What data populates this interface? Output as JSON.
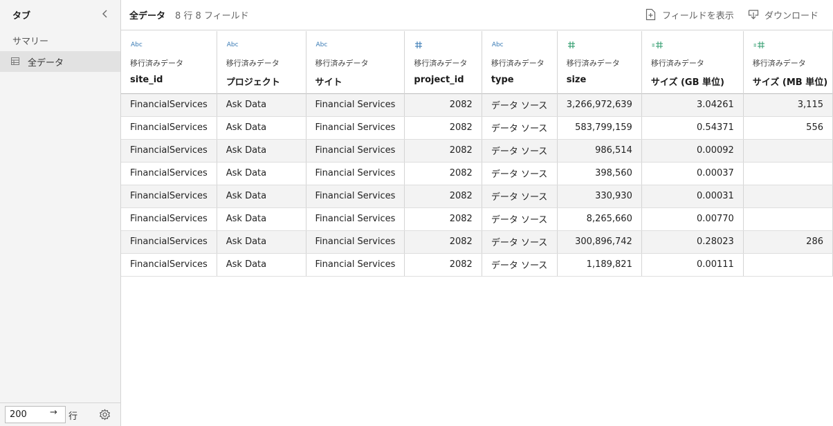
{
  "sidebar": {
    "title": "タブ",
    "summary_label": "サマリー",
    "items": [
      {
        "label": "全データ",
        "icon": "table-icon"
      }
    ],
    "rows_value": "200",
    "rows_unit": "行"
  },
  "header": {
    "title": "全データ",
    "count": "8 行 8 フィールド",
    "show_fields_label": "フィールドを表示",
    "download_label": "ダウンロード"
  },
  "columns": [
    {
      "type_icon": "Abc",
      "origin": "移行済みデータ",
      "name": "site_id",
      "align": "left"
    },
    {
      "type_icon": "Abc",
      "origin": "移行済みデータ",
      "name": "プロジェクト",
      "align": "left"
    },
    {
      "type_icon": "Abc",
      "origin": "移行済みデータ",
      "name": "サイト",
      "align": "left"
    },
    {
      "type_icon": "number",
      "origin": "移行済みデータ",
      "name": "project_id",
      "align": "right"
    },
    {
      "type_icon": "Abc",
      "origin": "移行済みデータ",
      "name": "type",
      "align": "left"
    },
    {
      "type_icon": "number-green",
      "origin": "移行済みデータ",
      "name": "size",
      "align": "right"
    },
    {
      "type_icon": "calc-number",
      "origin": "移行済みデータ",
      "name": "サイズ (GB 単位)",
      "align": "right"
    },
    {
      "type_icon": "calc-number",
      "origin": "移行済みデータ",
      "name": "サイズ (MB 単位)",
      "align": "right"
    }
  ],
  "rows": [
    [
      "FinancialServices",
      "Ask Data",
      "Financial Services",
      "2082",
      "データ ソース",
      "3,266,972,639",
      "3.04261",
      "3,115"
    ],
    [
      "FinancialServices",
      "Ask Data",
      "Financial Services",
      "2082",
      "データ ソース",
      "583,799,159",
      "0.54371",
      "556"
    ],
    [
      "FinancialServices",
      "Ask Data",
      "Financial Services",
      "2082",
      "データ ソース",
      "986,514",
      "0.00092",
      ""
    ],
    [
      "FinancialServices",
      "Ask Data",
      "Financial Services",
      "2082",
      "データ ソース",
      "398,560",
      "0.00037",
      ""
    ],
    [
      "FinancialServices",
      "Ask Data",
      "Financial Services",
      "2082",
      "データ ソース",
      "330,930",
      "0.00031",
      ""
    ],
    [
      "FinancialServices",
      "Ask Data",
      "Financial Services",
      "2082",
      "データ ソース",
      "8,265,660",
      "0.00770",
      ""
    ],
    [
      "FinancialServices",
      "Ask Data",
      "Financial Services",
      "2082",
      "データ ソース",
      "300,896,742",
      "0.28023",
      "286"
    ],
    [
      "FinancialServices",
      "Ask Data",
      "Financial Services",
      "2082",
      "データ ソース",
      "1,189,821",
      "0.00111",
      ""
    ]
  ],
  "colors": {
    "abc_icon": "#3a7bb5",
    "number_icon": "#3a7bb5",
    "measure_icon": "#2a9a6a",
    "stripe": "#f3f3f3"
  }
}
